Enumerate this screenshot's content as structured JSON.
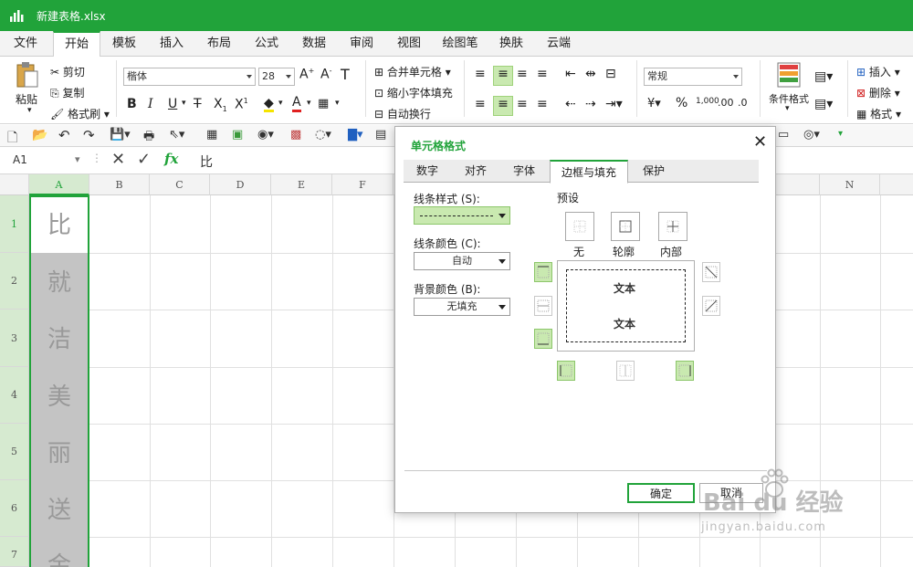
{
  "window": {
    "title": "新建表格.xlsx"
  },
  "menu": {
    "tabs": [
      "文件",
      "开始",
      "模板",
      "插入",
      "布局",
      "公式",
      "数据",
      "审阅",
      "视图",
      "绘图笔",
      "换肤",
      "云端"
    ],
    "active": "开始"
  },
  "ribbon": {
    "paste": "粘贴",
    "cut": "剪切",
    "copy": "复制",
    "format_painter": "格式刷",
    "font_name": "楷体",
    "font_size": "28",
    "merge_cells": "合并单元格",
    "shrink_to_fit": "缩小字体填充",
    "wrap_text": "自动换行",
    "number_format": "常规",
    "percent": "%",
    "conditional_format": "条件格式",
    "insert": "插入",
    "delete": "删除",
    "format": "格式"
  },
  "formula_bar": {
    "cell_ref": "A1",
    "fx": "fx",
    "value": "比"
  },
  "columns": [
    "A",
    "B",
    "C",
    "D",
    "E",
    "F",
    "N"
  ],
  "rows": [
    "1",
    "2",
    "3",
    "4",
    "5",
    "6",
    "7"
  ],
  "cells_a": [
    "比",
    "就",
    "洁",
    "美",
    "丽",
    "送",
    "金"
  ],
  "dialog": {
    "title": "单元格格式",
    "tabs": [
      "数字",
      "对齐",
      "字体",
      "边框与填充",
      "保护"
    ],
    "active_tab": "边框与填充",
    "line_style_label": "线条样式 (S):",
    "line_color_label": "线条颜色 (C):",
    "line_color_value": "自动",
    "bg_color_label": "背景颜色 (B):",
    "bg_color_value": "无填充",
    "preset_label": "预设",
    "preset_none": "无",
    "preset_outline": "轮廓",
    "preset_inside": "内部",
    "preview_text_1": "文本",
    "preview_text_2": "文本",
    "ok": "确定",
    "cancel": "取消"
  },
  "watermark": {
    "text": "Bai du 经验",
    "url": "jingyan.baidu.com"
  },
  "colors": {
    "accent": "#21a33a",
    "highlight": "#c9e9b0"
  }
}
